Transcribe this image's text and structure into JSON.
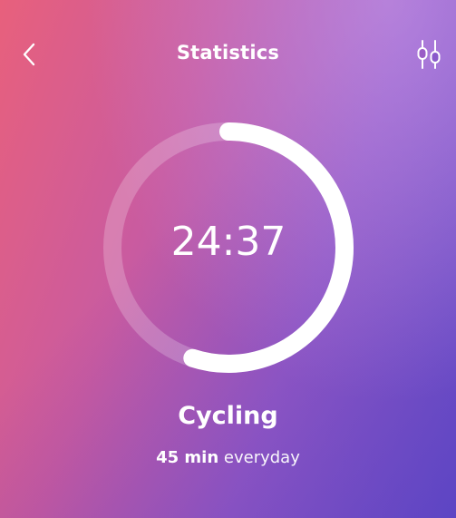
{
  "header": {
    "title": "Statistics",
    "back_icon": "chevron-left-icon",
    "filter_icon": "sliders-icon"
  },
  "timer": {
    "value": "24:37",
    "progress": 0.55
  },
  "activity": {
    "name": "Cycling"
  },
  "goal": {
    "amount": "45 min",
    "frequency": "everyday"
  },
  "colors": {
    "gradient_start": "#e8607c",
    "gradient_end": "#6e54cc",
    "ring_track": "rgba(255,255,255,0.25)",
    "ring_progress": "#ffffff"
  }
}
